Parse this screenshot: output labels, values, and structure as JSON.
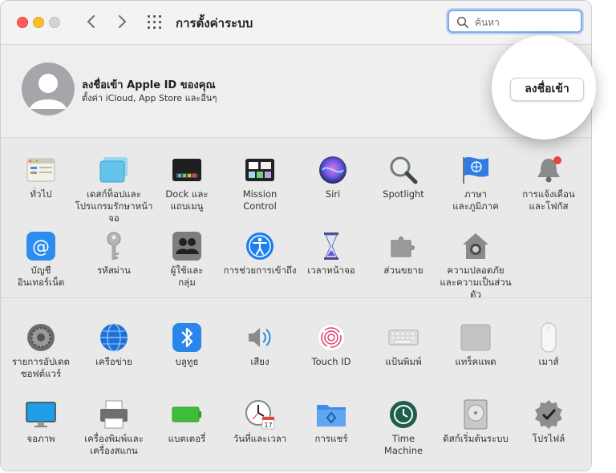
{
  "window": {
    "title": "การตั้งค่าระบบ"
  },
  "search": {
    "placeholder": "ค้นหา"
  },
  "account": {
    "title": "ลงชื่อเข้า Apple ID ของคุณ",
    "subtitle": "ตั้งค่า iCloud, App Store และอื่นๆ",
    "signin_label": "ลงชื่อเข้า"
  },
  "section1": [
    {
      "label": "ทั่วไป",
      "icon": "general-icon"
    },
    {
      "label": "เดสก์ท็อปและ\nโปรแกรมรักษาหน้าจอ",
      "icon": "desktop-screensaver-icon"
    },
    {
      "label": "Dock และ\nแถบเมนู",
      "icon": "dock-icon"
    },
    {
      "label": "Mission\nControl",
      "icon": "mission-control-icon"
    },
    {
      "label": "Siri",
      "icon": "siri-icon"
    },
    {
      "label": "Spotlight",
      "icon": "spotlight-icon"
    },
    {
      "label": "ภาษา\nและภูมิภาค",
      "icon": "language-region-icon"
    },
    {
      "label": "การแจ้งเตือน\nและโฟกัส",
      "icon": "notifications-icon"
    },
    {
      "label": "บัญชี\nอินเทอร์เน็ต",
      "icon": "internet-accounts-icon"
    },
    {
      "label": "รหัสผ่าน",
      "icon": "passwords-icon"
    },
    {
      "label": "ผู้ใช้และ\nกลุ่ม",
      "icon": "users-groups-icon"
    },
    {
      "label": "การช่วยการเข้าถึง",
      "icon": "accessibility-icon"
    },
    {
      "label": "เวลาหน้าจอ",
      "icon": "screen-time-icon"
    },
    {
      "label": "ส่วนขยาย",
      "icon": "extensions-icon"
    },
    {
      "label": "ความปลอดภัย\nและความเป็นส่วนตัว",
      "icon": "security-privacy-icon"
    }
  ],
  "section2": [
    {
      "label": "รายการอัปเดต\nซอฟต์แวร์",
      "icon": "software-update-icon"
    },
    {
      "label": "เครือข่าย",
      "icon": "network-icon"
    },
    {
      "label": "บลูทูธ",
      "icon": "bluetooth-icon"
    },
    {
      "label": "เสียง",
      "icon": "sound-icon"
    },
    {
      "label": "Touch ID",
      "icon": "touch-id-icon"
    },
    {
      "label": "แป้นพิมพ์",
      "icon": "keyboard-icon"
    },
    {
      "label": "แทร็คแพด",
      "icon": "trackpad-icon"
    },
    {
      "label": "เมาส์",
      "icon": "mouse-icon"
    },
    {
      "label": "จอภาพ",
      "icon": "displays-icon"
    },
    {
      "label": "เครื่องพิมพ์และ\nเครื่องสแกน",
      "icon": "printers-scanners-icon"
    },
    {
      "label": "แบตเตอรี่",
      "icon": "battery-icon"
    },
    {
      "label": "วันที่และเวลา",
      "icon": "date-time-icon"
    },
    {
      "label": "การแชร์",
      "icon": "sharing-icon"
    },
    {
      "label": "Time\nMachine",
      "icon": "time-machine-icon"
    },
    {
      "label": "ดิสก์เริ่มต้นระบบ",
      "icon": "startup-disk-icon"
    },
    {
      "label": "โปรไฟล์",
      "icon": "profiles-icon"
    }
  ],
  "calendar_day": "17",
  "colors": {
    "accent": "#3d7ff5",
    "search_ring": "#7fa9e6",
    "window_bg": "#ececec"
  }
}
